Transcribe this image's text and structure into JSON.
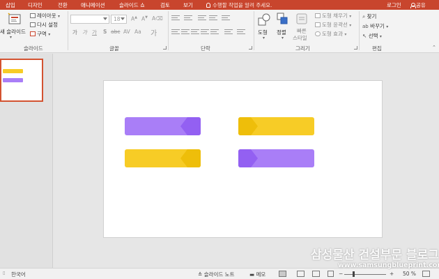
{
  "tabs": [
    "삽입",
    "디자인",
    "전환",
    "애니메이션",
    "슬라이드 쇼",
    "검토",
    "보기"
  ],
  "tell_me": "수행할 작업을 알려 주세요.",
  "login": "로그인",
  "share": "공유",
  "ribbon": {
    "slides": {
      "new_slide": "새 슬라이드",
      "layout": "레이아웃",
      "reset": "다시 설정",
      "section": "구역",
      "label": "슬라이드"
    },
    "font": {
      "size": "18",
      "label": "글꼴"
    },
    "paragraph": {
      "label": "단락"
    },
    "drawing": {
      "shapes": "도형",
      "arrange": "정렬",
      "quick_styles_line1": "빠른",
      "quick_styles_line2": "스타일",
      "fill": "도형 채우기",
      "outline": "도형 윤곽선",
      "effects": "도형 효과",
      "label": "그리기"
    },
    "editing": {
      "find": "찾기",
      "replace": "바꾸기",
      "select": "선택",
      "label": "편집"
    }
  },
  "slide": {
    "purple": "#a97ef7",
    "purple_dark": "#9360f2",
    "yellow": "#f7cc26",
    "yellow_dark": "#eebe0a"
  },
  "status": {
    "language": "한국어",
    "notes": "슬라이드 노트",
    "comments": "메모",
    "zoom": "50 %",
    "zoom_level": 0.5
  },
  "watermark": {
    "title": "삼성물산 건설부문 블로그",
    "url": "www.samsungblueprint.com"
  }
}
